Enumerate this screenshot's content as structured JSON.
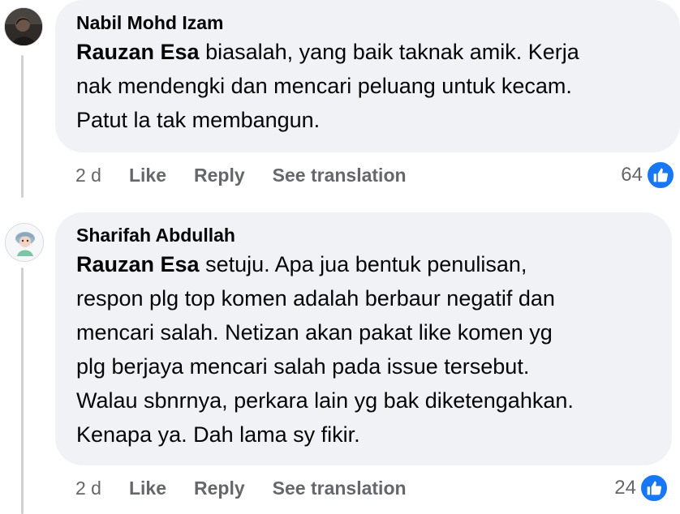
{
  "comments": [
    {
      "author": "Nabil Mohd Izam",
      "mention": "Rauzan Esa",
      "text": " biasalah, yang baik taknak amik. Kerja\nnak mendengki dan mencari peluang untuk kecam.\nPatut la tak membangun.",
      "time": "2 d",
      "like_label": "Like",
      "reply_label": "Reply",
      "translate_label": "See translation",
      "reaction_count": "64",
      "reaction_icon": "thumbs-up-icon",
      "avatar_icon": "profile-photo"
    },
    {
      "author": "Sharifah Abdullah",
      "mention": "Rauzan Esa",
      "text": " setuju. Apa jua bentuk penulisan,\nrespon plg top komen adalah berbaur negatif dan\nmencari salah. Netizan akan pakat like komen yg\nplg berjaya mencari salah pada issue tersebut.\nWalau sbnrnya, perkara lain yg bak diketengahkan.\nKenapa ya. Dah lama sy fikir.",
      "time": "2 d",
      "like_label": "Like",
      "reply_label": "Reply",
      "translate_label": "See translation",
      "reaction_count": "24",
      "reaction_icon": "thumbs-up-icon",
      "avatar_icon": "profile-photo"
    }
  ],
  "colors": {
    "bubble": "#f0f2f5",
    "meta_text": "#65676b",
    "like_blue": "#1877f2",
    "thread_line": "#ced0d4"
  }
}
